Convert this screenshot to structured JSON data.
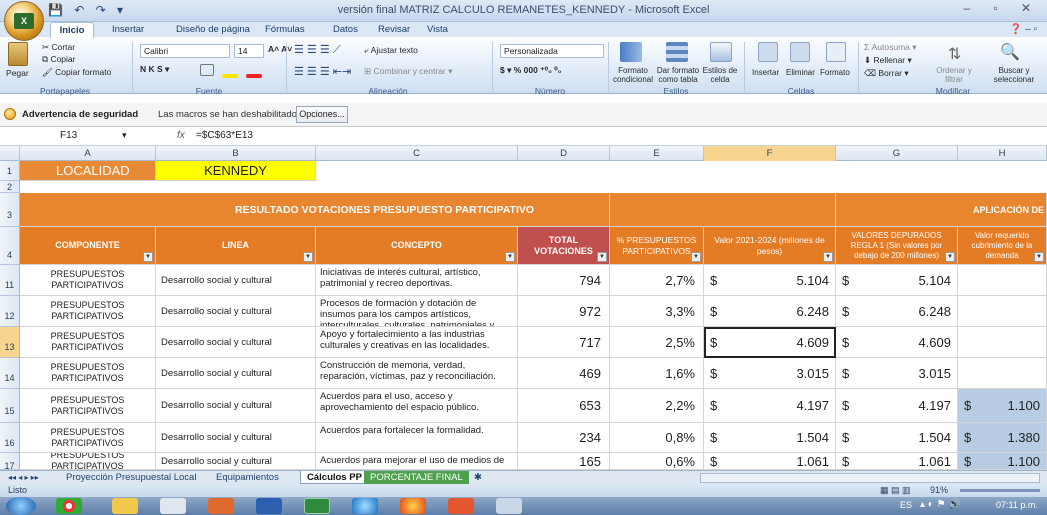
{
  "window": {
    "title": "versión final MATRIZ CALCULO REMANETES_KENNEDY - Microsoft Excel"
  },
  "tabs": [
    "Inicio",
    "Insertar",
    "Diseño de página",
    "Fórmulas",
    "Datos",
    "Revisar",
    "Vista"
  ],
  "ribbon": {
    "clipboard": {
      "paste": "Pegar",
      "cut": "Cortar",
      "copy": "Copiar",
      "format_painter": "Copiar formato",
      "group": "Portapapeles"
    },
    "font": {
      "name": "Calibri",
      "size": "14",
      "group": "Fuente"
    },
    "alignment": {
      "wrap": "Ajustar texto",
      "merge": "Combinar y centrar",
      "group": "Alineación"
    },
    "number": {
      "format": "Personalizada",
      "group": "Número"
    },
    "styles": {
      "conditional": "Formato condicional",
      "table": "Dar formato como tabla",
      "cell": "Estilos de celda",
      "group": "Estilos"
    },
    "cells": {
      "insert": "Insertar",
      "delete": "Eliminar",
      "format": "Formato",
      "group": "Celdas"
    },
    "editing": {
      "autosum": "Autosuma",
      "fill": "Rellenar",
      "clear": "Borrar",
      "sort": "Ordenar y filtrar",
      "find": "Buscar y seleccionar",
      "group": "Modificar"
    }
  },
  "security": {
    "title": "Advertencia de seguridad",
    "message": "Las macros se han deshabilitado.",
    "options": "Opciones..."
  },
  "formula_bar": {
    "name_box": "F13",
    "fx": "fx",
    "formula": "=$C$63*E13"
  },
  "columns": [
    "A",
    "B",
    "C",
    "D",
    "E",
    "F",
    "G",
    "H"
  ],
  "row1": {
    "num": "1",
    "label": "LOCALIDAD",
    "value": "KENNEDY"
  },
  "banner": {
    "title": "RESULTADO VOTACIONES PRESUPUESTO PARTICIPATIVO",
    "right": "APLICACIÓN DE"
  },
  "headers": {
    "componente": "COMPONENTE",
    "linea": "LINEA",
    "concepto": "CONCEPTO",
    "total": "TOTAL VOTACIONES",
    "pct": "% PRESUPUESTOS PARTICIPATIVOS",
    "valor": "Valor 2021-2024 (millones de pesos)",
    "depurados": "VALORES DEPURADOS REGLA 1 (Sin valores por debajo de 200 millones)",
    "requerido": "Valor requerido cubrimiento de la demanda"
  },
  "rows": [
    {
      "row": "11",
      "componente": "PRESUPUESTOS PARTICIPATIVOS",
      "linea": "Desarrollo social y cultural",
      "concepto": "Iniciativas de interés cultural, artístico, patrimonial y recreo deportivas.",
      "total": "794",
      "pct": "2,7%",
      "cur": "$",
      "valor": "5.104",
      "cur2": "$",
      "dep": "5.104",
      "cur3": "",
      "req": ""
    },
    {
      "row": "12",
      "componente": "PRESUPUESTOS PARTICIPATIVOS",
      "linea": "Desarrollo social y cultural",
      "concepto": "Procesos de formación y dotación de insumos para los campos artísticos, interculturales, culturales, patrimoniales y deportivos.",
      "total": "972",
      "pct": "3,3%",
      "cur": "$",
      "valor": "6.248",
      "cur2": "$",
      "dep": "6.248",
      "cur3": "",
      "req": ""
    },
    {
      "row": "13",
      "componente": "PRESUPUESTOS PARTICIPATIVOS",
      "linea": "Desarrollo social y cultural",
      "concepto": "Apoyo y fortalecimiento a las industrias culturales y creativas en las localidades.",
      "total": "717",
      "pct": "2,5%",
      "cur": "$",
      "valor": "4.609",
      "cur2": "$",
      "dep": "4.609",
      "cur3": "",
      "req": ""
    },
    {
      "row": "14",
      "componente": "PRESUPUESTOS PARTICIPATIVOS",
      "linea": "Desarrollo social y cultural",
      "concepto": "Construcción de memoria, verdad, reparación, víctimas, paz y reconciliación.",
      "total": "469",
      "pct": "1,6%",
      "cur": "$",
      "valor": "3.015",
      "cur2": "$",
      "dep": "3.015",
      "cur3": "",
      "req": ""
    },
    {
      "row": "15",
      "componente": "PRESUPUESTOS PARTICIPATIVOS",
      "linea": "Desarrollo social y cultural",
      "concepto": "Acuerdos para el uso, acceso y aprovechamiento del espacio público.",
      "total": "653",
      "pct": "2,2%",
      "cur": "$",
      "valor": "4.197",
      "cur2": "$",
      "dep": "4.197",
      "cur3": "$",
      "req": "1.100"
    },
    {
      "row": "16",
      "componente": "PRESUPUESTOS PARTICIPATIVOS",
      "linea": "Desarrollo social y cultural",
      "concepto": "Acuerdos para fortalecer la formalidad.",
      "total": "234",
      "pct": "0,8%",
      "cur": "$",
      "valor": "1.504",
      "cur2": "$",
      "dep": "1.504",
      "cur3": "$",
      "req": "1.380"
    },
    {
      "row": "17",
      "componente": "PRESUPUESTOS PARTICIPATIVOS",
      "linea": "Desarrollo social y cultural",
      "concepto": "Acuerdos para mejorar el uso de medios de",
      "total": "165",
      "pct": "0,6%",
      "cur": "$",
      "valor": "1.061",
      "cur2": "$",
      "dep": "1.061",
      "cur3": "$",
      "req": "1.100"
    }
  ],
  "sheets": [
    "Proyección Presupuestal Local",
    "Equipamientos",
    "Cálculos PP",
    "PORCENTAJE FINAL"
  ],
  "status": {
    "ready": "Listo",
    "zoom": "91%"
  },
  "taskbar": {
    "lang": "ES",
    "time": "07:11 p.m."
  }
}
